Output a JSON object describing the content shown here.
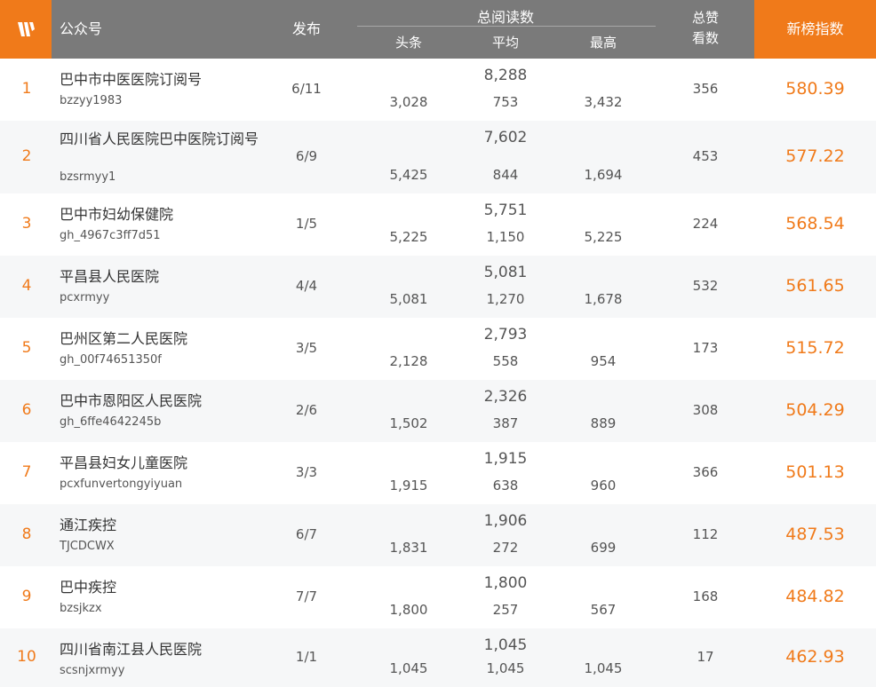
{
  "colors": {
    "accent": "#f07a1a",
    "header_bg": "#7a7a7a",
    "alt_row": "#f6f7f8"
  },
  "header": {
    "logo_icon": "w-logo-icon",
    "name": "公众号",
    "publish": "发布",
    "total_reads": "总阅读数",
    "sub_head": "头条",
    "sub_avg": "平均",
    "sub_max": "最高",
    "likes_line1": "总赞",
    "likes_line2": "看数",
    "index": "新榜指数"
  },
  "rows": [
    {
      "rank": "1",
      "title": "巴中市中医医院订阅号",
      "account": "bzzyy1983",
      "publish": "6/11",
      "total": "8,288",
      "head": "3,028",
      "avg": "753",
      "max": "3,432",
      "likes": "356",
      "index": "580.39"
    },
    {
      "rank": "2",
      "title": "四川省人民医院巴中医院订阅号",
      "account": "bzsrmyy1",
      "publish": "6/9",
      "total": "7,602",
      "head": "5,425",
      "avg": "844",
      "max": "1,694",
      "likes": "453",
      "index": "577.22"
    },
    {
      "rank": "3",
      "title": "巴中市妇幼保健院",
      "account": "gh_4967c3ff7d51",
      "publish": "1/5",
      "total": "5,751",
      "head": "5,225",
      "avg": "1,150",
      "max": "5,225",
      "likes": "224",
      "index": "568.54"
    },
    {
      "rank": "4",
      "title": "平昌县人民医院",
      "account": "pcxrmyy",
      "publish": "4/4",
      "total": "5,081",
      "head": "5,081",
      "avg": "1,270",
      "max": "1,678",
      "likes": "532",
      "index": "561.65"
    },
    {
      "rank": "5",
      "title": "巴州区第二人民医院",
      "account": "gh_00f74651350f",
      "publish": "3/5",
      "total": "2,793",
      "head": "2,128",
      "avg": "558",
      "max": "954",
      "likes": "173",
      "index": "515.72"
    },
    {
      "rank": "6",
      "title": "巴中市恩阳区人民医院",
      "account": "gh_6ffe4642245b",
      "publish": "2/6",
      "total": "2,326",
      "head": "1,502",
      "avg": "387",
      "max": "889",
      "likes": "308",
      "index": "504.29"
    },
    {
      "rank": "7",
      "title": "平昌县妇女儿童医院",
      "account": "pcxfunvertongyiyuan",
      "publish": "3/3",
      "total": "1,915",
      "head": "1,915",
      "avg": "638",
      "max": "960",
      "likes": "366",
      "index": "501.13"
    },
    {
      "rank": "8",
      "title": "通江疾控",
      "account": "TJCDCWX",
      "publish": "6/7",
      "total": "1,906",
      "head": "1,831",
      "avg": "272",
      "max": "699",
      "likes": "112",
      "index": "487.53"
    },
    {
      "rank": "9",
      "title": "巴中疾控",
      "account": "bzsjkzx",
      "publish": "7/7",
      "total": "1,800",
      "head": "1,800",
      "avg": "257",
      "max": "567",
      "likes": "168",
      "index": "484.82"
    },
    {
      "rank": "10",
      "title": "四川省南江县人民医院",
      "account": "scsnjxrmyy",
      "publish": "1/1",
      "total": "1,045",
      "head": "1,045",
      "avg": "1,045",
      "max": "1,045",
      "likes": "17",
      "index": "462.93"
    }
  ]
}
